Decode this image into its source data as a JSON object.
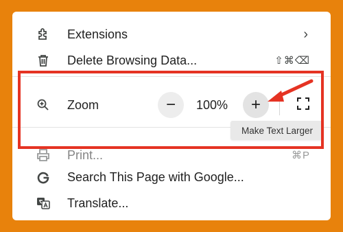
{
  "menu": {
    "extensions": {
      "label": "Extensions",
      "icon": "puzzle-icon",
      "chevron": "›"
    },
    "delete_data": {
      "label": "Delete Browsing Data...",
      "icon": "trash-icon",
      "shortcut": "⇧⌘⌫"
    },
    "zoom": {
      "label": "Zoom",
      "icon": "zoom-in-icon",
      "decrease_label": "−",
      "value": "100%",
      "increase_label": "+",
      "fullscreen_icon": "fullscreen-icon"
    },
    "print": {
      "label": "Print...",
      "icon": "printer-icon",
      "shortcut": "⌘P"
    },
    "search_google": {
      "label": "Search This Page with Google...",
      "icon": "google-g-icon"
    },
    "translate": {
      "label": "Translate...",
      "icon": "translate-icon"
    }
  },
  "tooltip": {
    "text": "Make Text Larger"
  },
  "colors": {
    "background": "#E8820C",
    "highlight": "#E53323",
    "arrow": "#E53323"
  }
}
